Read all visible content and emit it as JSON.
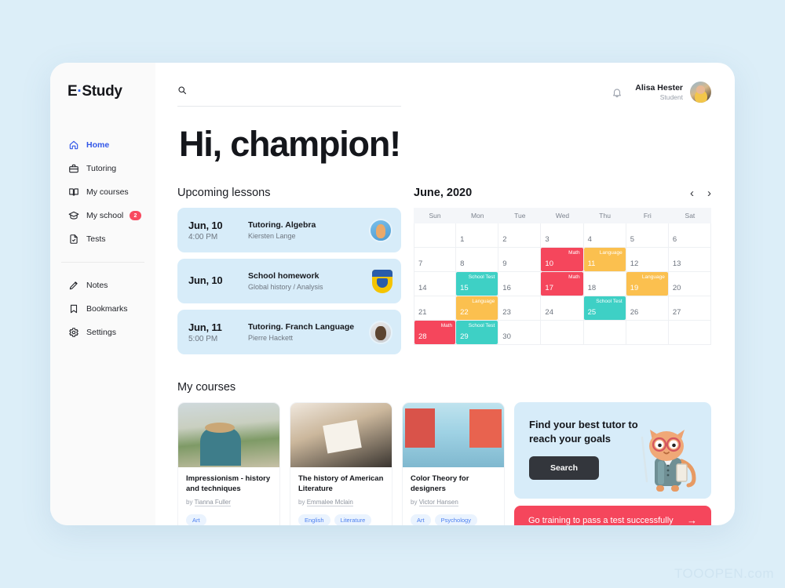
{
  "brand": {
    "name_left": "E",
    "dot": "·",
    "name_right": "Study"
  },
  "sidebar": {
    "primary": [
      {
        "label": "Home",
        "icon": "home-icon",
        "active": true,
        "badge": null
      },
      {
        "label": "Tutoring",
        "icon": "briefcase-icon",
        "active": false,
        "badge": null
      },
      {
        "label": "My courses",
        "icon": "book-icon",
        "active": false,
        "badge": null
      },
      {
        "label": "My school",
        "icon": "graduation-cap-icon",
        "active": false,
        "badge": "2"
      },
      {
        "label": "Tests",
        "icon": "document-check-icon",
        "active": false,
        "badge": null
      }
    ],
    "secondary": [
      {
        "label": "Notes",
        "icon": "pencil-icon"
      },
      {
        "label": "Bookmarks",
        "icon": "bookmark-icon"
      },
      {
        "label": "Settings",
        "icon": "gear-icon"
      }
    ]
  },
  "search": {
    "value": "",
    "placeholder": ""
  },
  "user": {
    "name": "Alisa Hester",
    "role": "Student"
  },
  "greeting": "Hi, champion!",
  "lessons_section": {
    "title": "Upcoming lessons"
  },
  "lessons": [
    {
      "date": "Jun, 10",
      "time": "4:00 PM",
      "title": "Tutoring. Algebra",
      "subtitle": "Kiersten Lange",
      "avatar": "tutor-photo-female"
    },
    {
      "date": "Jun, 10",
      "time": "",
      "title": "School homework",
      "subtitle": "Global history / Analysis",
      "avatar": "school-crest-icon"
    },
    {
      "date": "Jun, 11",
      "time": "5:00 PM",
      "title": "Tutoring. Franch Language",
      "subtitle": "Pierre Hackett",
      "avatar": "tutor-photo-male"
    }
  ],
  "calendar": {
    "title": "June, 2020",
    "prev_icon": "chevron-left-icon",
    "next_icon": "chevron-right-icon",
    "dow": [
      "Sun",
      "Mon",
      "Tue",
      "Wed",
      "Thu",
      "Fri",
      "Sat"
    ],
    "event_colors": {
      "Math": "#f5465c",
      "Language": "#fbc04f",
      "School Test": "#3ed0c5"
    },
    "cells": [
      {
        "day": "",
        "event": null
      },
      {
        "day": "1",
        "event": null
      },
      {
        "day": "2",
        "event": null
      },
      {
        "day": "3",
        "event": null
      },
      {
        "day": "4",
        "event": null
      },
      {
        "day": "5",
        "event": null
      },
      {
        "day": "6",
        "event": null
      },
      {
        "day": "7",
        "event": null
      },
      {
        "day": "8",
        "event": null
      },
      {
        "day": "9",
        "event": null
      },
      {
        "day": "10",
        "event": "Math"
      },
      {
        "day": "11",
        "event": "Language"
      },
      {
        "day": "12",
        "event": null
      },
      {
        "day": "13",
        "event": null
      },
      {
        "day": "14",
        "event": null
      },
      {
        "day": "15",
        "event": "School Test"
      },
      {
        "day": "16",
        "event": null
      },
      {
        "day": "17",
        "event": "Math"
      },
      {
        "day": "18",
        "event": null
      },
      {
        "day": "19",
        "event": "Language"
      },
      {
        "day": "20",
        "event": null
      },
      {
        "day": "21",
        "event": null
      },
      {
        "day": "22",
        "event": "Language"
      },
      {
        "day": "23",
        "event": null
      },
      {
        "day": "24",
        "event": null
      },
      {
        "day": "25",
        "event": "School Test"
      },
      {
        "day": "26",
        "event": null
      },
      {
        "day": "27",
        "event": null
      },
      {
        "day": "28",
        "event": "Math"
      },
      {
        "day": "29",
        "event": "School Test"
      },
      {
        "day": "30",
        "event": null
      },
      {
        "day": "",
        "event": null
      },
      {
        "day": "",
        "event": null
      },
      {
        "day": "",
        "event": null
      },
      {
        "day": "",
        "event": null
      }
    ]
  },
  "courses_section": {
    "title": "My courses"
  },
  "courses": [
    {
      "title": "Impressionism - history and techniques",
      "by_label": "by",
      "author": "Tianna Fuller",
      "tags": [
        "Art"
      ],
      "thumb": "painter-landscape-photo"
    },
    {
      "title": "The history of American Literature",
      "by_label": "by",
      "author": "Emmalee Mclain",
      "tags": [
        "English",
        "Literature"
      ],
      "thumb": "reading-book-photo"
    },
    {
      "title": "Color Theory for designers",
      "by_label": "by",
      "author": "Victor Hansen",
      "tags": [
        "Art",
        "Psychology"
      ],
      "thumb": "colorful-houses-canal-photo"
    }
  ],
  "promo": {
    "title": "Find your best tutor to reach your goals",
    "button": "Search",
    "mascot": "cat-teacher-mascot-icon"
  },
  "cta": {
    "label": "Go training to pass a test successfully",
    "arrow": "→"
  },
  "watermark": "TOOOPEN.com"
}
